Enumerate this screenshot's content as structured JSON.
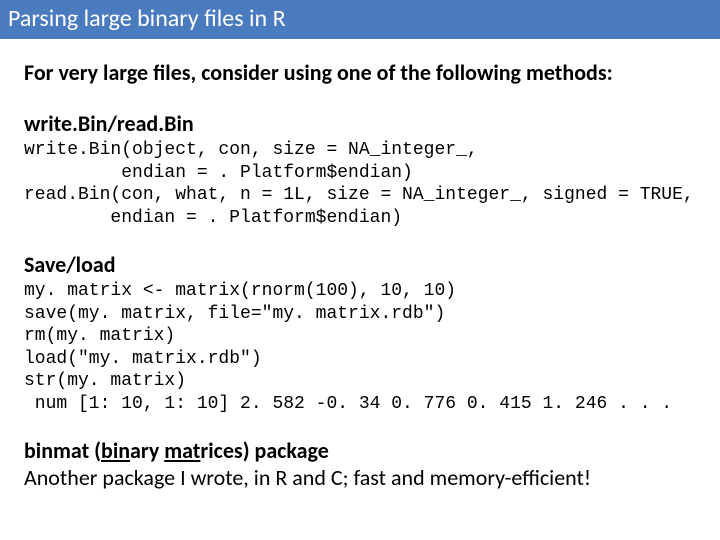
{
  "title": "Parsing large binary files in R",
  "lead": "For very large files, consider using one of the following methods:",
  "sections": {
    "bin": {
      "heading": "write.Bin/read.Bin",
      "code": "write.Bin(object, con, size = NA_integer_,\n         endian = . Platform$endian)\nread.Bin(con, what, n = 1L, size = NA_integer_, signed = TRUE,\n        endian = . Platform$endian)"
    },
    "saveload": {
      "heading": "Save/load",
      "code": "my. matrix <- matrix(rnorm(100), 10, 10)\nsave(my. matrix, file=\"my. matrix.rdb\")\nrm(my. matrix)\nload(\"my. matrix.rdb\")\nstr(my. matrix)\n num [1: 10, 1: 10] 2. 582 -0. 34 0. 776 0. 415 1. 246 . . ."
    }
  },
  "footer": {
    "pkg_prefix": "binmat (",
    "pkg_u1": "bin",
    "pkg_mid1": "ary ",
    "pkg_u2": "mat",
    "pkg_mid2": "rices) package",
    "line2": "Another package I wrote, in R and C; fast and memory-efficient!"
  }
}
